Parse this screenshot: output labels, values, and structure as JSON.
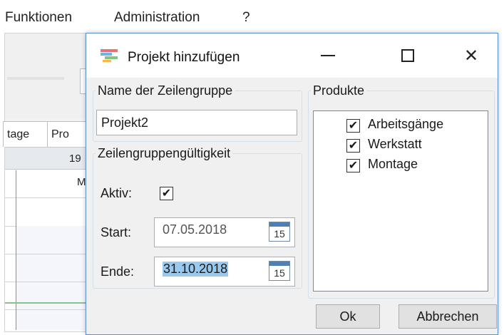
{
  "app": {
    "menu": [
      "Funktionen",
      "Administration",
      "?"
    ],
    "tabs": [
      "tage",
      "Pro"
    ],
    "grid": {
      "header_value": "19",
      "cell_value": "M"
    },
    "colors": {
      "green_line": "#86c28d",
      "accent": "#5a8fd0"
    }
  },
  "dialog": {
    "title": "Projekt hinzufügen",
    "icon": "project-icon",
    "window_buttons": [
      "minimize-icon",
      "maximize-icon",
      "close-icon"
    ],
    "close_glyph": "✕",
    "name_group": {
      "legend": "Name der Zeilengruppe",
      "value": "Projekt2"
    },
    "validity_group": {
      "legend": "Zeilengruppengültigkeit",
      "active_label": "Aktiv:",
      "active_checked": true,
      "start_label": "Start:",
      "start_value": "07.05.2018",
      "end_label": "Ende:",
      "end_value": "31.10.2018",
      "calendar_day": "15"
    },
    "products_group": {
      "legend": "Produkte",
      "items": [
        {
          "label": "Arbeitsgänge",
          "checked": true
        },
        {
          "label": "Werkstatt",
          "checked": true
        },
        {
          "label": "Montage",
          "checked": true
        }
      ]
    },
    "buttons": {
      "ok": "Ok",
      "cancel": "Abbrechen"
    },
    "check_glyph": "✔"
  }
}
